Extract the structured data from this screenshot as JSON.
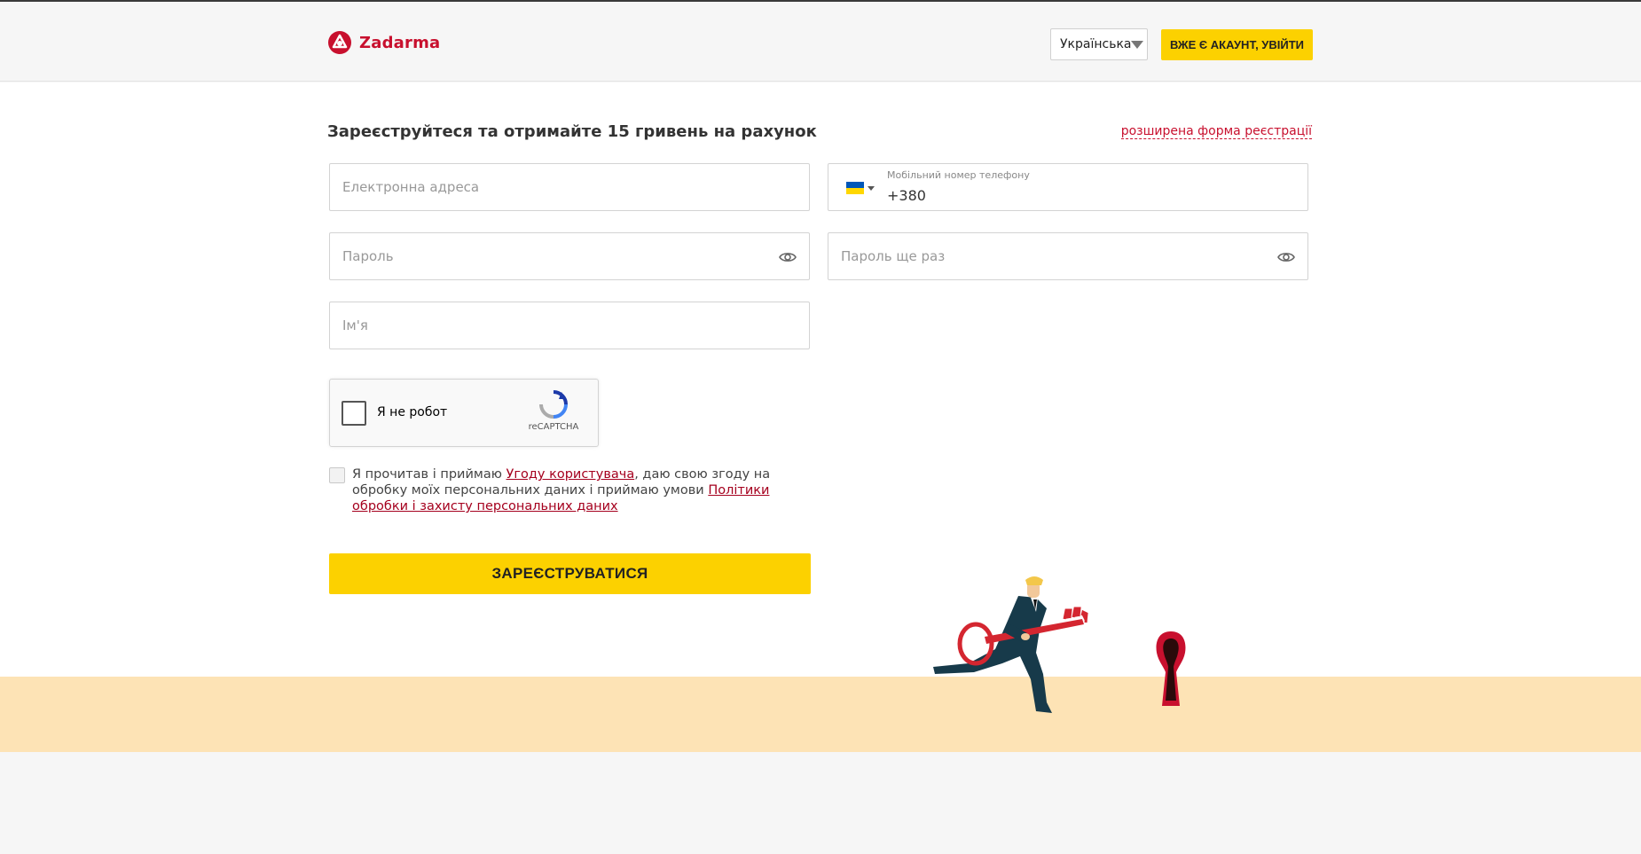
{
  "header": {
    "brand": "Zadarma",
    "language": "Українська",
    "login_label": "ВЖЕ Є АКАУНТ, УВІЙТИ"
  },
  "form": {
    "title": "Зареєструйтеся та отримайте 15 гривень на рахунок",
    "advanced_link": "розширена форма реєстрації",
    "email_placeholder": "Електронна адреса",
    "phone_label": "Мобільний номер телефону",
    "phone_value": "+380",
    "password_placeholder": "Пароль",
    "password_repeat_placeholder": "Пароль ще раз",
    "name_placeholder": "Ім'я",
    "recaptcha_label": "Я не робот",
    "recaptcha_brand": "reCAPTCHA",
    "agree_part1": "Я прочитав і приймаю ",
    "agree_link1": "Угоду користувача",
    "agree_part2": ", даю свою згоду на обробку моїх персональних даних і приймаю умови ",
    "agree_link2": "Політики обробки і захисту персональних даних",
    "submit_label": "ЗАРЕЄСТРУВАТИСЯ"
  },
  "colors": {
    "accent_yellow": "#fcd100",
    "brand_red": "#c8102e",
    "ground": "#fde3b5"
  }
}
